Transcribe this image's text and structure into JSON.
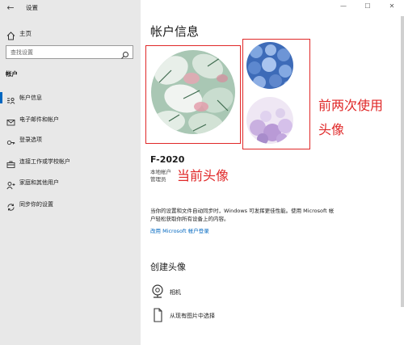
{
  "window": {
    "title": "设置",
    "back_glyph": "←",
    "minimize_glyph": "—",
    "maximize_glyph": "☐",
    "close_glyph": "✕"
  },
  "sidebar": {
    "home_label": "主页",
    "search_placeholder": "查找设置",
    "section_title": "帐户",
    "items": [
      {
        "label": "帐户信息",
        "icon": "person-card-icon",
        "active": true
      },
      {
        "label": "电子邮件和帐户",
        "icon": "mail-icon",
        "active": false
      },
      {
        "label": "登录选项",
        "icon": "key-icon",
        "active": false
      },
      {
        "label": "连接工作或学校帐户",
        "icon": "briefcase-icon",
        "active": false
      },
      {
        "label": "家庭和其他用户",
        "icon": "people-icon",
        "active": false
      },
      {
        "label": "同步你的设置",
        "icon": "sync-icon",
        "active": false
      }
    ]
  },
  "main": {
    "title": "帐户信息",
    "user_name": "F-2020",
    "account_type": "本地帐户",
    "role": "管理员",
    "description": "当你的设置和文件自动同步时，Windows 可发挥更佳性能。使用 Microsoft 帐户轻松获取你所有设备上的内容。",
    "ms_link": "改用 Microsoft 帐户登录",
    "create_title": "创建头像",
    "options": [
      {
        "label": "相机",
        "icon": "camera-icon"
      },
      {
        "label": "从现有图片中选择",
        "icon": "image-file-icon"
      }
    ]
  },
  "annotations": {
    "current_avatar": "当前头像",
    "previous_avatars_line1": "前两次使用",
    "previous_avatars_line2": "头像",
    "color": "#e02828"
  },
  "colors": {
    "sidebar_bg": "#e8e8e8",
    "accent": "#0067c0",
    "annotation_red": "#e02828"
  }
}
